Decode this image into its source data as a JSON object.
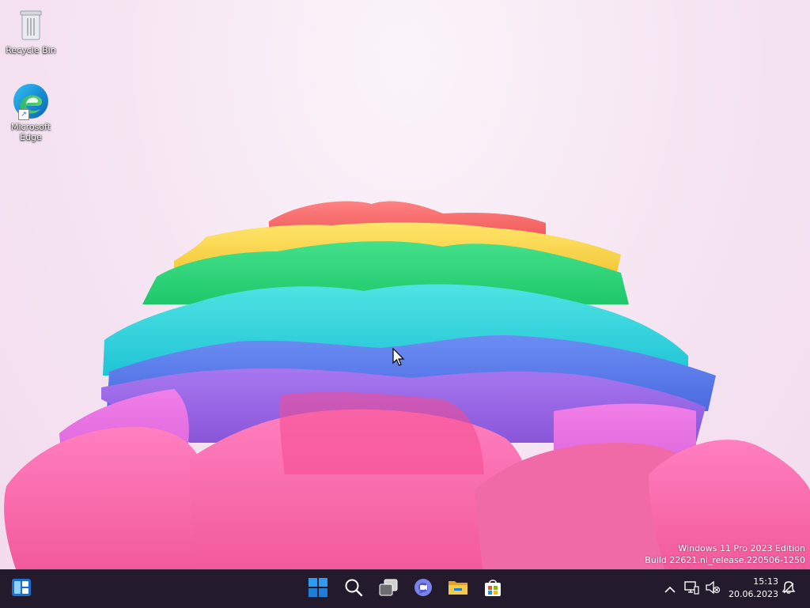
{
  "desktop": {
    "icons": [
      {
        "label": "Recycle Bin",
        "icon": "recycle-bin-icon"
      },
      {
        "label": "Microsoft Edge",
        "icon": "edge-icon"
      }
    ],
    "watermark": {
      "line1": "Windows 11 Pro 2023 Edition",
      "line2": "Build 22621.ni_release.220506-1250"
    }
  },
  "taskbar": {
    "widgets_icon": "widgets-icon",
    "pinned": [
      {
        "name": "Start",
        "icon": "windows-start-icon"
      },
      {
        "name": "Search",
        "icon": "search-icon"
      },
      {
        "name": "Task View",
        "icon": "task-view-icon"
      },
      {
        "name": "Chat",
        "icon": "teams-chat-icon"
      },
      {
        "name": "File Explorer",
        "icon": "folder-icon"
      },
      {
        "name": "Microsoft Store",
        "icon": "store-icon"
      }
    ],
    "tray": {
      "chevron_icon": "chevron-up-icon",
      "network_icon": "network-icon",
      "volume_icon": "volume-muted-icon",
      "notification_icon": "notification-icon",
      "time": "15:13",
      "date": "20.06.2023"
    }
  },
  "colors": {
    "taskbar": "#231a2b",
    "windows_blue": "#1f8ee8",
    "folder_yellow": "#f5b82e"
  }
}
